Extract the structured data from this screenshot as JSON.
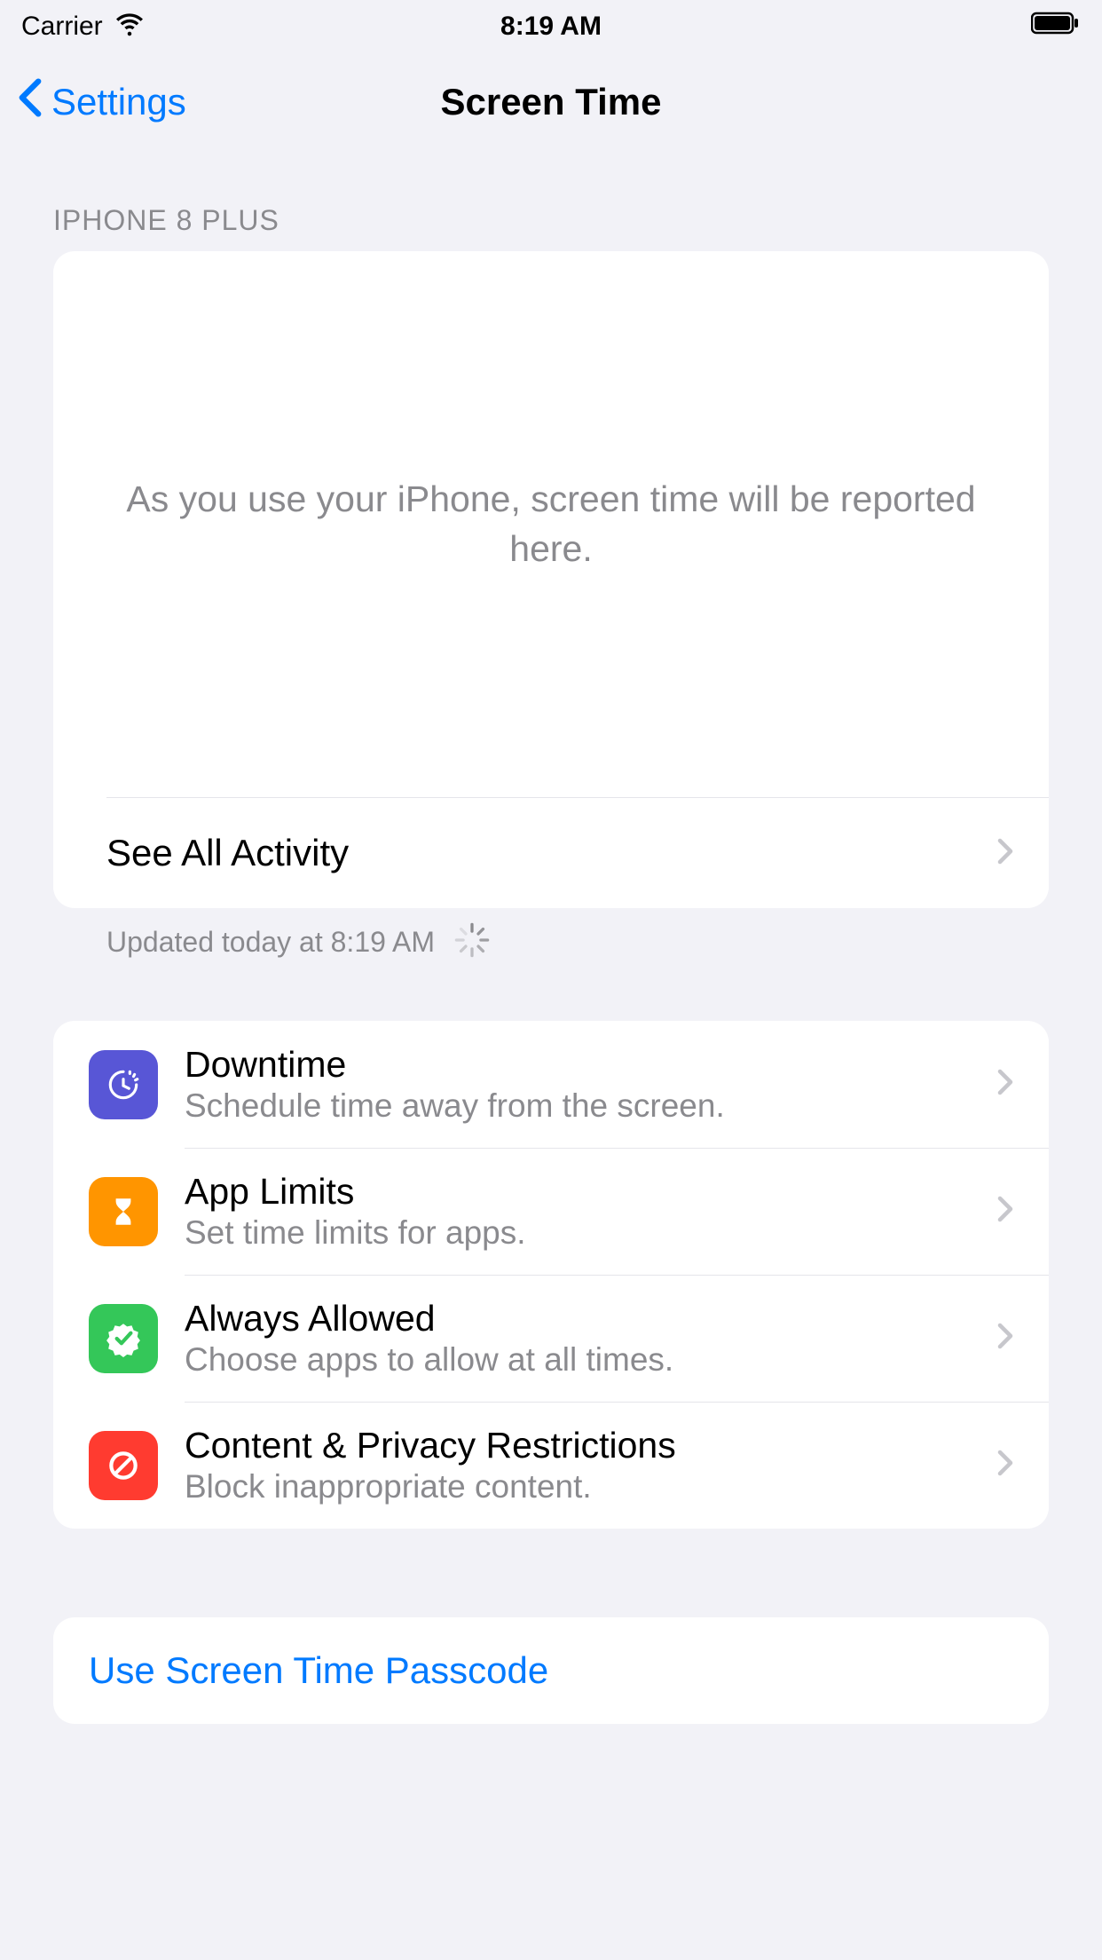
{
  "status_bar": {
    "carrier": "Carrier",
    "time": "8:19 AM"
  },
  "nav": {
    "back_label": "Settings",
    "title": "Screen Time"
  },
  "section_header": "IPHONE 8 PLUS",
  "activity": {
    "empty_text": "As you use your iPhone, screen time will be reported here.",
    "see_all_label": "See All Activity",
    "updated_label": "Updated today at 8:19 AM"
  },
  "options": [
    {
      "title": "Downtime",
      "subtitle": "Schedule time away from the screen."
    },
    {
      "title": "App Limits",
      "subtitle": "Set time limits for apps."
    },
    {
      "title": "Always Allowed",
      "subtitle": "Choose apps to allow at all times."
    },
    {
      "title": "Content & Privacy Restrictions",
      "subtitle": "Block inappropriate content."
    }
  ],
  "passcode_link": "Use Screen Time Passcode"
}
